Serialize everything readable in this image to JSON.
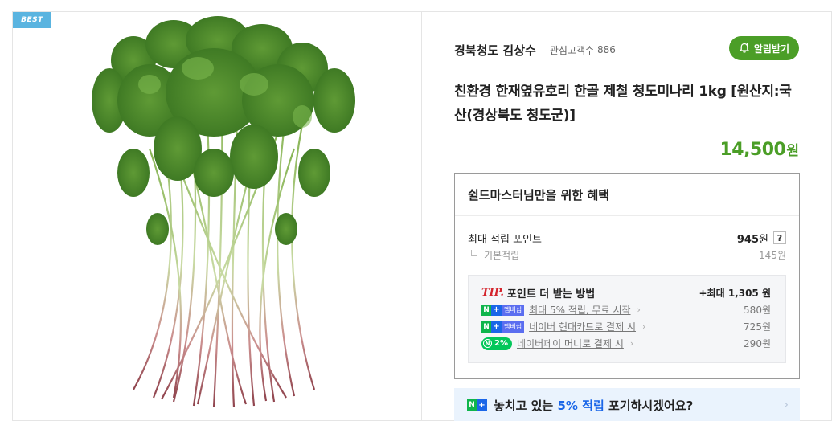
{
  "image": {
    "badge": "BEST",
    "alt": "청도미나리 묶음"
  },
  "seller": {
    "name": "경북청도 김상수",
    "interest_label": "관심고객수",
    "interest_count": "886",
    "alarm_button": "알림받기"
  },
  "product": {
    "title": "친환경 한재옆유호리 한골 제철 청도미나리 1kg [원산지:국산(경상북도 청도군)]",
    "price": "14,500",
    "price_unit": "원"
  },
  "benefit": {
    "title": "쉴드마스터님만을 위한 혜택",
    "max_point_label": "최대 적립 포인트",
    "max_point_value": "945",
    "max_point_unit": "원",
    "help_label": "?",
    "base_label": "기본적립",
    "base_value": "145원",
    "tip": {
      "mark": "TIP.",
      "title": "포인트 더 받는 방법",
      "max": "+최대 1,305 원",
      "items": [
        {
          "badge_n": "N",
          "badge_plus": "+",
          "badge_text": "멤버십",
          "label": "최대 5% 적립, 무료 시작",
          "amount": "580원"
        },
        {
          "badge_n": "N",
          "badge_plus": "+",
          "badge_text": "멤버십",
          "label": "네이버 현대카드로 결제 시",
          "amount": "725원"
        },
        {
          "badge_circle": "N",
          "badge_text": "2%",
          "label": "네이버페이 머니로 결제 시",
          "amount": "290원"
        }
      ]
    }
  },
  "promo": {
    "badge_n": "N",
    "badge_plus": "+",
    "text_before": "놓치고 있는 ",
    "highlight": "5% 적립",
    "text_after": " 포기하시겠어요?"
  },
  "colors": {
    "brand_green": "#4b9e27",
    "naver_green": "#03c75a",
    "naver_blue": "#1a66e8",
    "tip_red": "#d4242c",
    "badge_blue": "#5ab4e0"
  }
}
